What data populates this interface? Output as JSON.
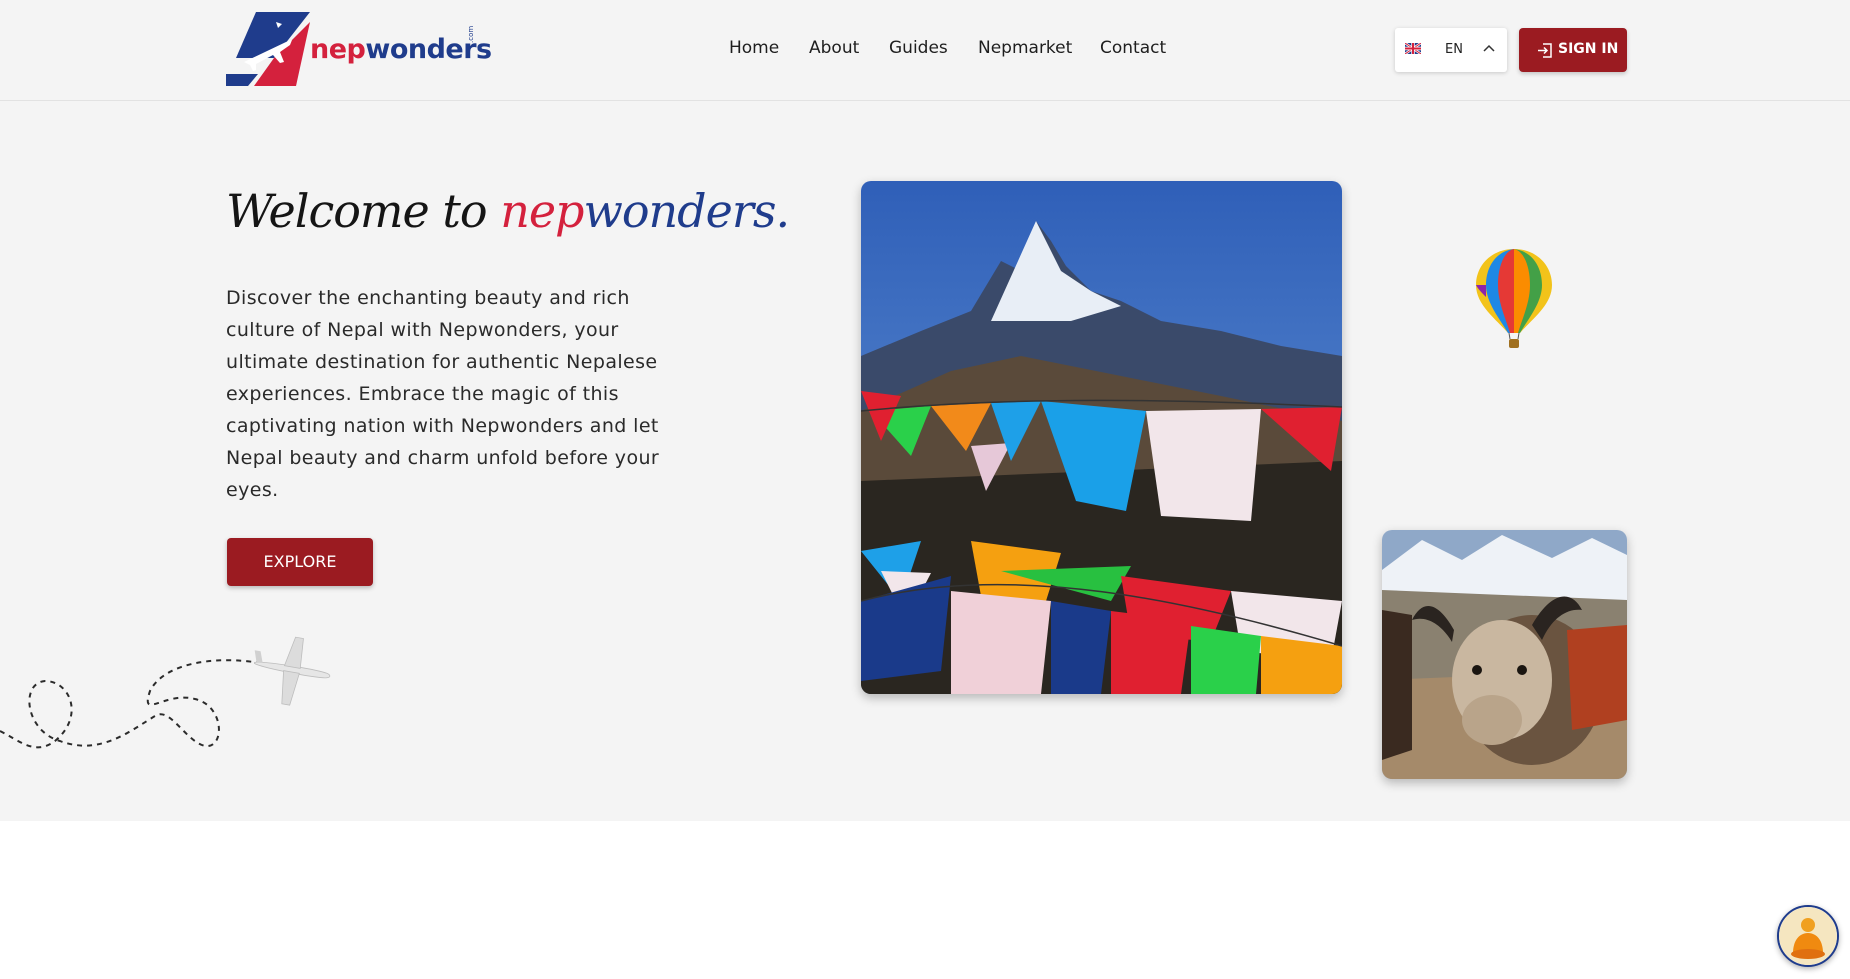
{
  "brand": {
    "name_part1": "nep",
    "name_part2": "wonders",
    "domain_suffix": ".com",
    "colors": {
      "red": "#d4213d",
      "blue": "#1f3c8c",
      "accent": "#9b1b21"
    }
  },
  "nav": {
    "items": [
      "Home",
      "About",
      "Guides",
      "Nepmarket",
      "Contact"
    ]
  },
  "language": {
    "code": "EN",
    "flag_icon": "uk-flag-icon",
    "chevron_icon": "chevron-up-icon"
  },
  "signin": {
    "label": "SIGN IN",
    "icon": "sign-in-icon"
  },
  "hero": {
    "welcome_prefix": "Welcome to ",
    "brand_part1": "nep",
    "brand_part2": "wonders.",
    "description": "Discover the enchanting beauty and rich culture of Nepal with Nepwonders, your ultimate destination for authentic Nepalese experiences. Embrace the magic of this captivating nation with Nepwonders and let Nepal beauty and charm unfold before your eyes.",
    "explore_label": "EXPLORE"
  },
  "images": {
    "main": "mountain-prayer-flags-image",
    "secondary": "yak-image",
    "balloon": "hot-air-balloon-icon",
    "plane": "airplane-icon",
    "chat": "buddha-chat-icon"
  }
}
